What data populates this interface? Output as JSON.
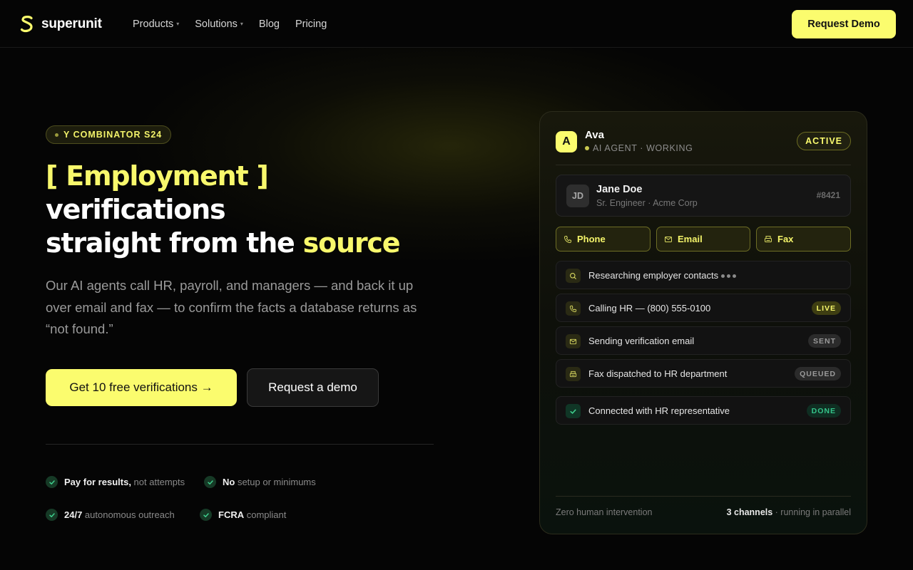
{
  "brand": {
    "name": "superunit",
    "accent": "#fbfc6e"
  },
  "nav": {
    "items": [
      {
        "label": "Products",
        "has_caret": true
      },
      {
        "label": "Solutions",
        "has_caret": true
      },
      {
        "label": "Blog",
        "has_caret": false
      },
      {
        "label": "Pricing",
        "has_caret": false
      }
    ],
    "cta": "Request Demo"
  },
  "hero": {
    "badge": "Y COMBINATOR S24",
    "title_line1": "[ Employment ]",
    "title_line2": "verifications",
    "title_line3_pre": "straight from the ",
    "title_line3_highlight": "source",
    "lead": "Our AI agents call HR, payroll, and managers — and back it up over email and fax — to confirm the facts a database returns as “not found.”",
    "primary_cta": "Get 10 free verifications →",
    "secondary_cta": "Request a demo",
    "features": [
      {
        "bold": "Pay for results,",
        "rest": " not attempts"
      },
      {
        "bold": "No",
        "rest": " setup or minimums"
      },
      {
        "bold": "24/7",
        "rest": " autonomous outreach"
      },
      {
        "bold": "FCRA",
        "rest": " compliant"
      }
    ]
  },
  "card": {
    "agent_initial": "A",
    "agent_name": "Ava",
    "agent_status": "AI AGENT · WORKING",
    "state": "ACTIVE",
    "person": {
      "initials": "JD",
      "name": "Jane Doe",
      "subtitle": "Sr. Engineer · Acme Corp",
      "id": "#8421"
    },
    "channels": [
      "Phone",
      "Email",
      "Fax"
    ],
    "steps": [
      {
        "icon": "search-icon",
        "text": "Researching employer contacts",
        "tag": ""
      },
      {
        "icon": "phone-icon",
        "text": "Calling HR — (800) 555-0100",
        "tag": "LIVE"
      },
      {
        "icon": "mail-icon",
        "text": "Sending verification email",
        "tag": "SENT"
      },
      {
        "icon": "fax-icon",
        "text": "Fax dispatched to HR department",
        "tag": "QUEUED"
      },
      {
        "icon": "check-icon",
        "text": "Connected with HR representative",
        "tag": "DONE"
      }
    ],
    "footer_left": "Zero human intervention",
    "footer_right_bold": "3 channels",
    "footer_right_rest": " · running in parallel"
  }
}
